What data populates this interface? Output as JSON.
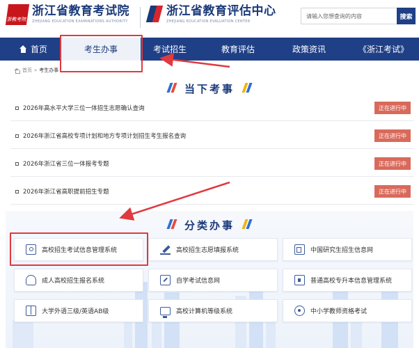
{
  "header": {
    "logo1": {
      "seal_text": "浙教考院",
      "title": "浙江省教育考试院",
      "subtitle": "ZHEJIANG EDUCATION EXAMINATIONS AUTHORITY"
    },
    "logo2": {
      "title": "浙江省教育评估中心",
      "subtitle": "ZHEJIANG EDUCATION EVALUATION CENTER"
    },
    "search": {
      "placeholder": "请输入您想查询的内容",
      "button": "搜索"
    }
  },
  "nav": {
    "items": [
      {
        "label": "首页",
        "icon": "home-icon"
      },
      {
        "label": "考生办事",
        "active": true
      },
      {
        "label": "考试招生"
      },
      {
        "label": "教育评估"
      },
      {
        "label": "政策资讯"
      },
      {
        "label": "《浙江考试》"
      }
    ]
  },
  "breadcrumb": {
    "home": "首页",
    "sep": "»",
    "current": "考生办事"
  },
  "current_section": {
    "title": "当下考事",
    "items": [
      {
        "label": "2026年高水平大学三位一体招生志愿确认查询",
        "status": "正在进行中"
      },
      {
        "label": "2026年浙江省高校专项计划和地方专项计划招生考生报名查询",
        "status": "正在进行中"
      },
      {
        "label": "2026年浙江省三位一体报考专题",
        "status": "正在进行中"
      },
      {
        "label": "2026年浙江省高职提前招生专题",
        "status": "正在进行中"
      }
    ]
  },
  "category_section": {
    "title": "分类办事",
    "items": [
      {
        "label": "高校招生考试信息管理系统",
        "icon": "monitor-icon"
      },
      {
        "label": "高校招生志愿填报系统",
        "icon": "pen-icon"
      },
      {
        "label": "中国研究生招生信息网",
        "icon": "id-card-icon"
      },
      {
        "label": "成人高校招生报名系统",
        "icon": "person-icon"
      },
      {
        "label": "自学考试信息网",
        "icon": "edit-icon"
      },
      {
        "label": "普通高校专升本信息管理系统",
        "icon": "lock-icon"
      },
      {
        "label": "大学外语三级/英语AB级",
        "icon": "book-icon"
      },
      {
        "label": "高校计算机等级系统",
        "icon": "computer-icon"
      },
      {
        "label": "中小学教师资格考试",
        "icon": "badge-icon"
      }
    ]
  },
  "colors": {
    "nav_bg": "#1f3f86",
    "brand_blue": "#1b3a7a",
    "status_red": "#d96a5b",
    "annotation_red": "#e0393e"
  }
}
